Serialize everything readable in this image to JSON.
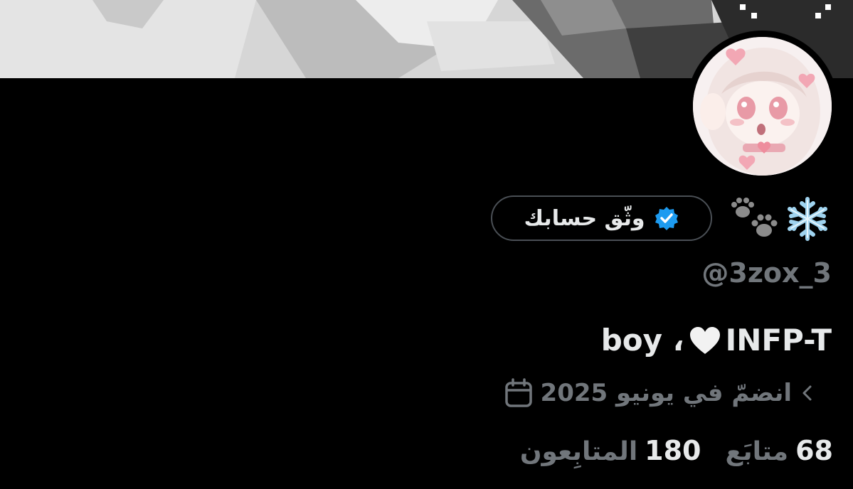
{
  "profile": {
    "handle": "@3zox_3",
    "bio_prefix": "INFP-T",
    "bio_suffix": "، boy",
    "name_emojis": [
      "snowflake-icon",
      "paw-prints-icon"
    ],
    "joined_text": "انضمّ في يونيو 2025",
    "verify_button_label": "وثّق حسابك"
  },
  "stats": {
    "following_count": "68",
    "following_label": "متابَع",
    "followers_count": "180",
    "followers_label": "المتابِعون"
  },
  "icons": {
    "verify_badge": "verified-badge-icon",
    "bio_heart": "white-heart-icon",
    "joined_calendar": "calendar-icon",
    "joined_chevron": "chevron-left-icon"
  },
  "colors": {
    "background": "#000000",
    "primary_text": "#e7e9ea",
    "secondary_text": "#71767b",
    "verified_blue": "#1d9bf0",
    "button_border": "#4a4f55"
  }
}
